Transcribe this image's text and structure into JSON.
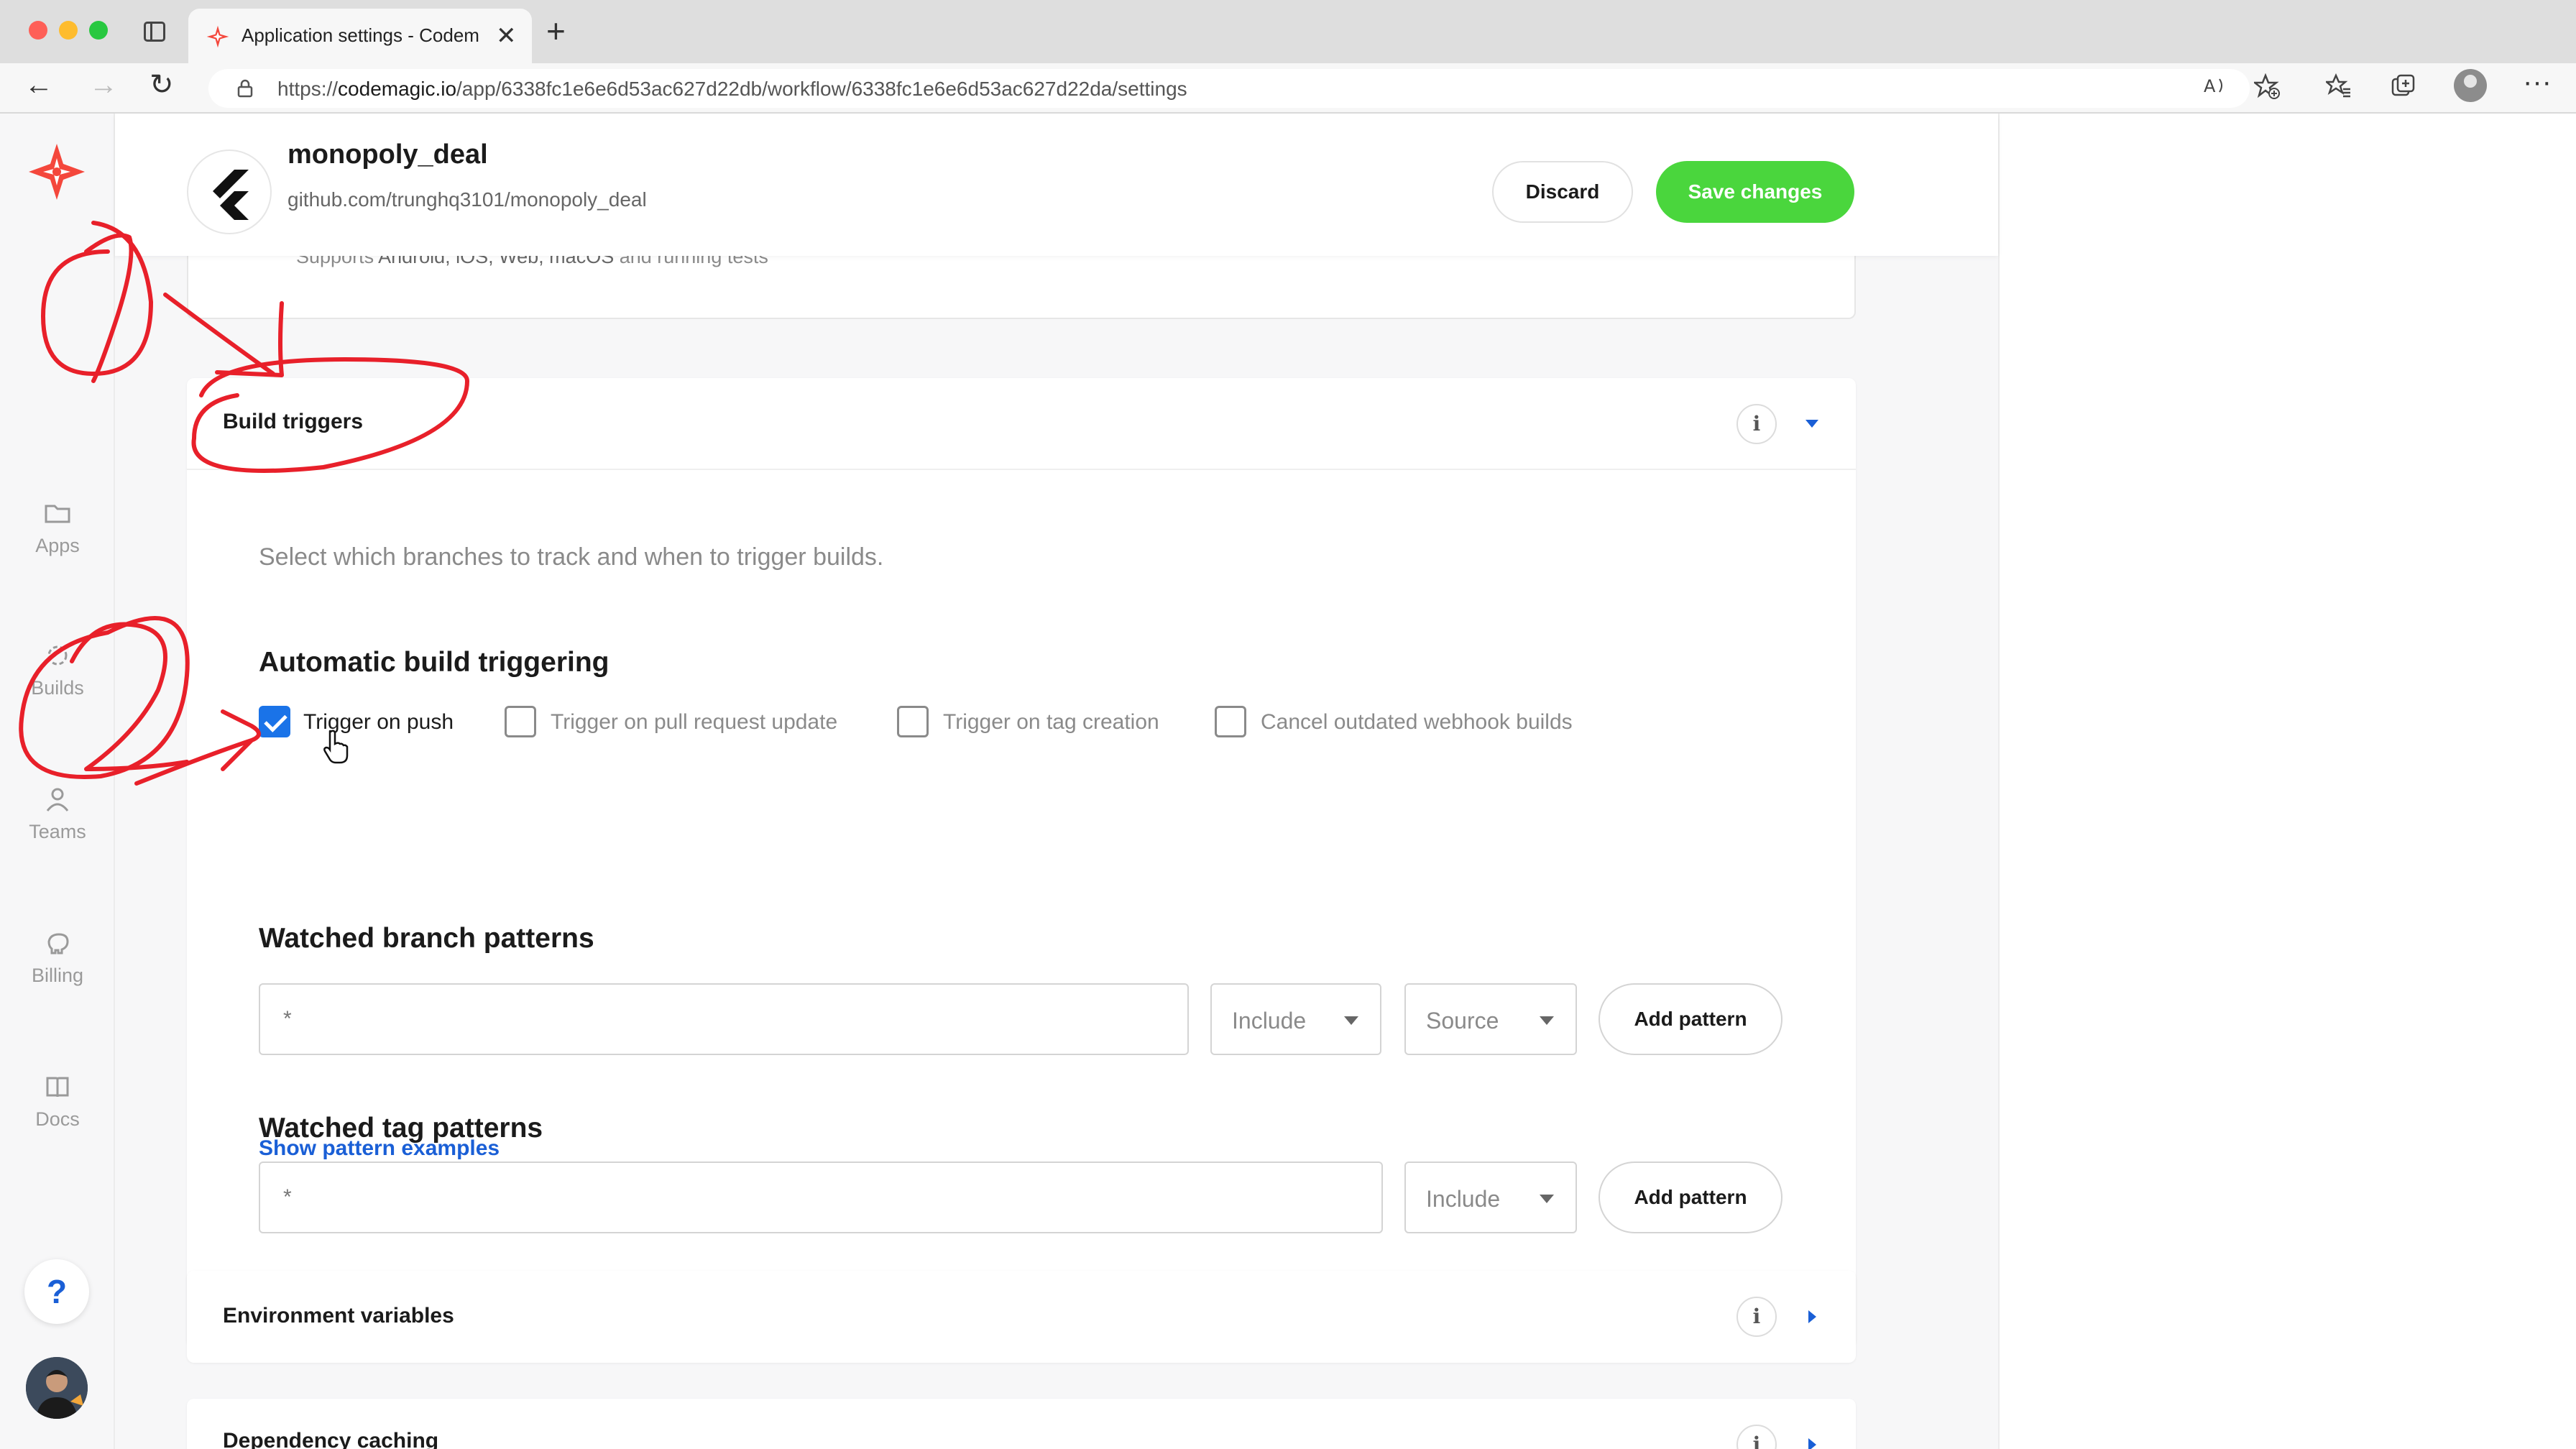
{
  "browser": {
    "tab_title": "Application settings - Codemagic",
    "tab_close": "✕",
    "new_tab": "+",
    "url_prefix": "https://",
    "url_host": "codemagic.io",
    "url_path": "/app/6338fc1e6e6d53ac627d22db/workflow/6338fc1e6e6d53ac627d22da/settings",
    "nav": {
      "back": "←",
      "forward": "→",
      "reload": "↻"
    },
    "icons": [
      "read-aloud-icon",
      "add-favorite-icon",
      "favorites-icon",
      "collections-icon",
      "profile-icon",
      "more-icon"
    ]
  },
  "sidebar": {
    "items": [
      {
        "label": "Apps",
        "icon": "folder-icon"
      },
      {
        "label": "Builds",
        "icon": "builds-icon"
      },
      {
        "label": "Teams",
        "icon": "person-icon"
      },
      {
        "label": "Billing",
        "icon": "piggy-bank-icon"
      },
      {
        "label": "Docs",
        "icon": "book-icon"
      }
    ],
    "help": "?"
  },
  "header": {
    "project_name": "monopoly_deal",
    "repo": "github.com/trunghq3101/monopoly_deal",
    "discard": "Discard",
    "save": "Save changes"
  },
  "previous_section": {
    "text_prefix": "Supports ",
    "text_bold": "Android, iOS, Web, macOS",
    "text_suffix": " and running tests"
  },
  "build_triggers": {
    "title": "Build triggers",
    "info": "i",
    "description": "Select which branches to track and when to trigger builds.",
    "automatic_title": "Automatic build triggering",
    "checkboxes": [
      {
        "label": "Trigger on push",
        "checked": true
      },
      {
        "label": "Trigger on pull request update",
        "checked": false
      },
      {
        "label": "Trigger on tag creation",
        "checked": false
      },
      {
        "label": "Cancel outdated webhook builds",
        "checked": false
      }
    ],
    "branch_patterns": {
      "title": "Watched branch patterns",
      "value": "*",
      "include": "Include",
      "source": "Source",
      "add": "Add pattern"
    },
    "tag_patterns": {
      "title": "Watched tag patterns",
      "value": "*",
      "include": "Include",
      "add": "Add pattern"
    },
    "examples_link": "Show pattern examples"
  },
  "sections": {
    "env_vars": "Environment variables",
    "dependency_caching": "Dependency caching"
  },
  "annotations": {
    "first": "1",
    "second": "2",
    "color": "#e8202a"
  },
  "colors": {
    "accent": "#1a5fd6",
    "save": "#4ad63d",
    "checkbox": "#1a73e8",
    "logo": "#f4473c"
  }
}
